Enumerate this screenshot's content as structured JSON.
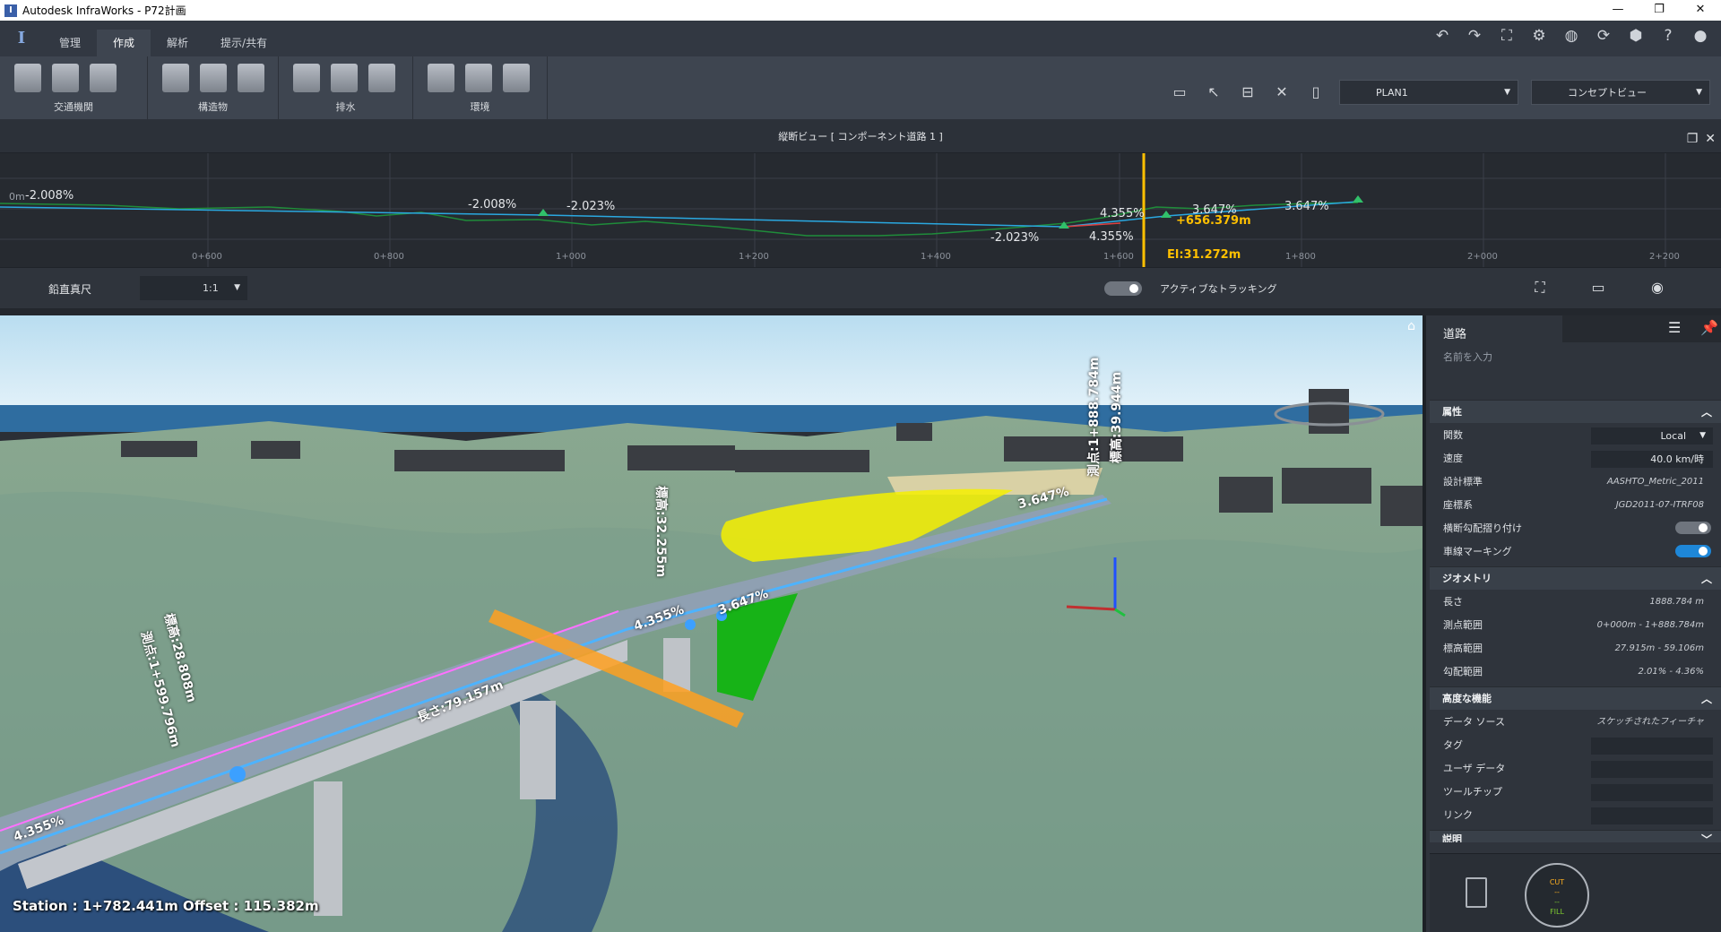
{
  "window": {
    "title": "Autodesk InfraWorks - P72計画",
    "app_letter": "I",
    "min": "—",
    "max": "❐",
    "close": "✕"
  },
  "tabs": [
    "管理",
    "作成",
    "解析",
    "提示/共有"
  ],
  "ribbon": {
    "groups": [
      "交通機関",
      "構造物",
      "排水",
      "環境"
    ],
    "plan_dropdown": "PLAN1",
    "view_dropdown": "コンセプトビュー"
  },
  "profile": {
    "title": "縦断ビュー [ コンポーネント道路 1 ]",
    "elev_label": "0m",
    "stations": [
      "0+600",
      "0+800",
      "1+000",
      "1+200",
      "1+400",
      "1+600",
      "1+800",
      "2+000",
      "2+200"
    ],
    "grades": [
      "-2.008%",
      "-2.008%",
      "-2.023%",
      "-2.023%",
      "4.355%",
      "4.355%",
      "3.647%",
      "3.647%"
    ],
    "cursor_station": "+656.379m",
    "cursor_elev": "El:31.272m",
    "scale_label": "鉛直真尺",
    "scale_value": "1:1",
    "tracking_label": "アクティブなトラッキング"
  },
  "viewport": {
    "station_readout": "Station : 1+782.441m Offset : 115.382m",
    "annotations": {
      "left_station": "測点:1+599.796m",
      "left_elev": "標高:28.808m",
      "mid_elev": "標高:32.255m",
      "length": "長さ:79.157m",
      "right_station": "測点:1+888.784m",
      "right_elev": "標高:39.944m",
      "grade_a": "4.355%",
      "grade_b": "3.647%",
      "grade_c": "3.647%",
      "grade_left": "4.355%"
    }
  },
  "panel": {
    "title": "道路",
    "name_placeholder": "名前を入力",
    "sections": {
      "attributes": "属性",
      "geometry": "ジオメトリ",
      "advanced": "高度な機能",
      "description": "説明"
    },
    "attributes": {
      "function_label": "関数",
      "function_value": "Local",
      "speed_label": "速度",
      "speed_value": "40.0  km/時",
      "design_label": "設計標準",
      "design_value": "AASHTO_Metric_2011",
      "crs_label": "座標系",
      "crs_value": "JGD2011-07-ITRF08",
      "superelev_label": "横断勾配摺り付け",
      "marking_label": "車線マーキング"
    },
    "geometry": {
      "length_label": "長さ",
      "length_value": "1888.784  m",
      "station_label": "測点範囲",
      "station_value": "0+000m - 1+888.784m",
      "elev_label": "標高範囲",
      "elev_value": "27.915m - 59.106m",
      "grade_label": "勾配範囲",
      "grade_value": "2.01% - 4.36%"
    },
    "advanced": {
      "source_label": "データ ソース",
      "source_value": "スケッチされたフィーチャ",
      "tag_label": "タグ",
      "userdata_label": "ユーザ データ",
      "tooltip_label": "ツールチップ",
      "link_label": "リンク"
    },
    "cutfill": {
      "cut": "CUT",
      "cut_val": "--",
      "fill_val": "--",
      "fill": "FILL"
    }
  }
}
